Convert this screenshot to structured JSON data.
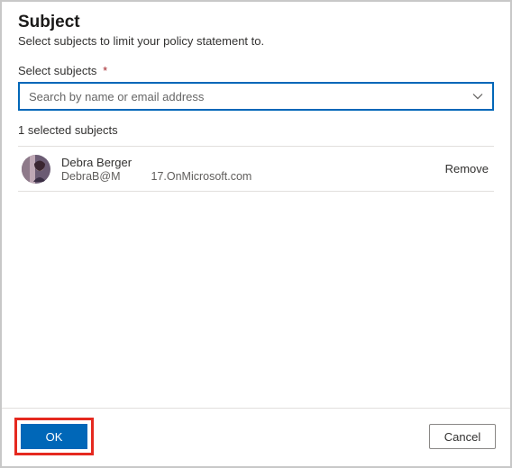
{
  "header": {
    "title": "Subject",
    "subtitle": "Select subjects to limit your policy statement to."
  },
  "selectField": {
    "label": "Select subjects",
    "requiredMark": "*",
    "placeholder": "Search by name or email address"
  },
  "selectedSummary": "1 selected subjects",
  "subjects": [
    {
      "name": "Debra Berger",
      "emailLocal": "DebraB@M",
      "emailDomain": "17.OnMicrosoft.com",
      "removeLabel": "Remove"
    }
  ],
  "footer": {
    "ok": "OK",
    "cancel": "Cancel"
  }
}
